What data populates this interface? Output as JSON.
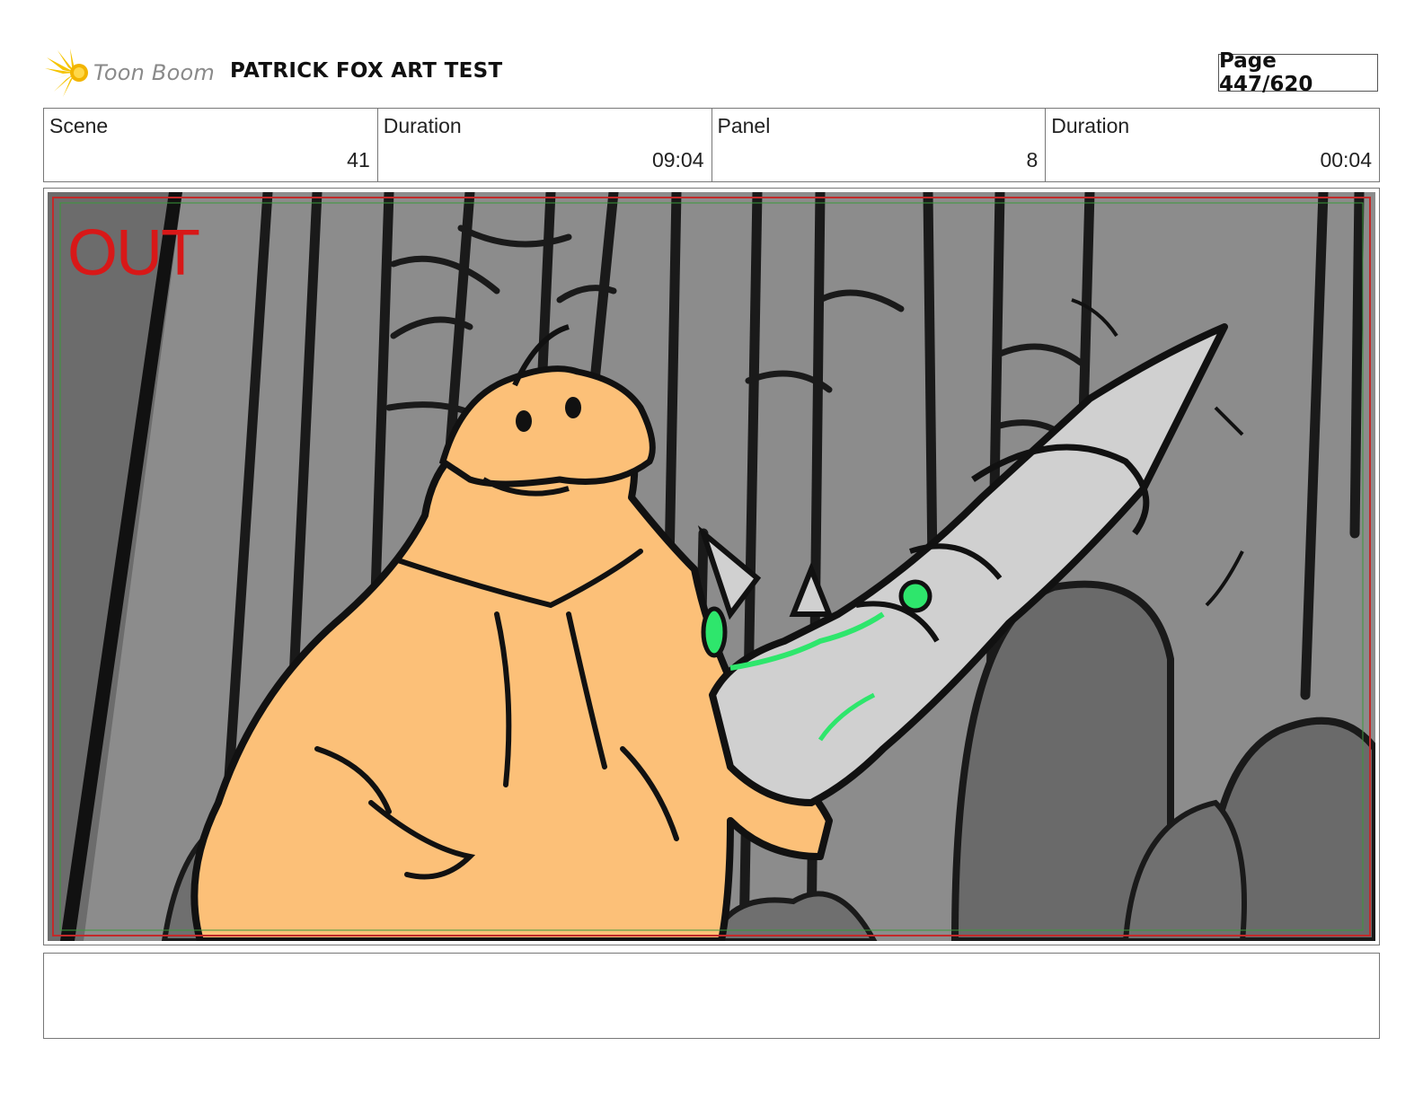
{
  "header": {
    "logo_text": "Toon Boom",
    "project_title": "PATRICK FOX ART TEST",
    "page_label": "Page 447/620"
  },
  "info": [
    {
      "label": "Scene",
      "value": "41"
    },
    {
      "label": "Duration",
      "value": "09:04"
    },
    {
      "label": "Panel",
      "value": "8"
    },
    {
      "label": "Duration",
      "value": "00:04"
    }
  ],
  "panel": {
    "overlay_text": "OUT",
    "colors": {
      "background": "#8c8c8c",
      "tree_dark": "#666666",
      "skin": "#fcc078",
      "weapon": "#d0d0d0",
      "accent_green": "#2ee66c",
      "frame_red": "#c22a2a"
    }
  },
  "notes": {}
}
